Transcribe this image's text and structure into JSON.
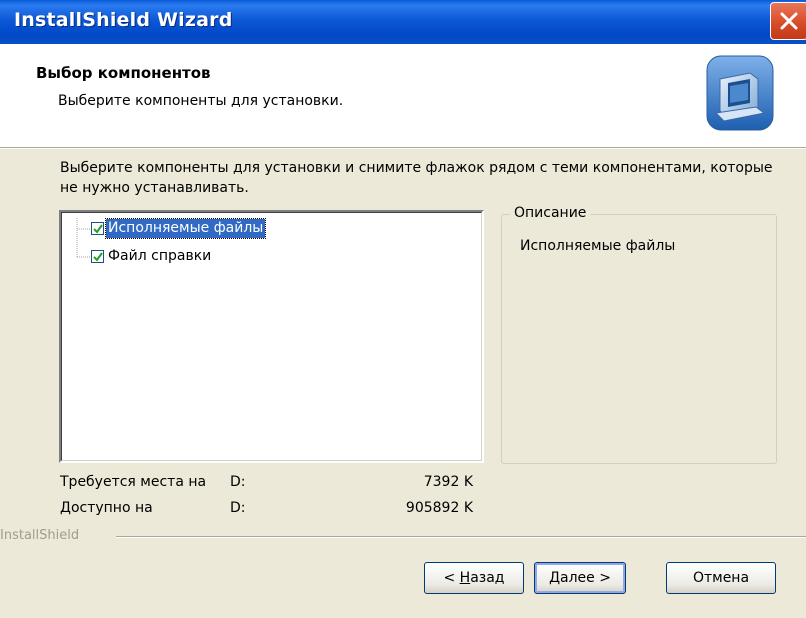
{
  "window": {
    "title": "InstallShield Wizard"
  },
  "header": {
    "title": "Выбор компонентов",
    "subtitle": "Выберите компоненты для установки."
  },
  "instructions": "Выберите компоненты для установки и снимите флажок рядом с теми компонентами, которые не нужно устанавливать.",
  "components": [
    {
      "label": "Исполняемые файлы",
      "checked": true,
      "selected": true
    },
    {
      "label": "Файл справки",
      "checked": true,
      "selected": false
    }
  ],
  "description": {
    "legend": "Описание",
    "text": "Исполняемые файлы"
  },
  "space": {
    "required_label": "Требуется места на",
    "required_drive": "D:",
    "required_size": "7392 K",
    "available_label": "Доступно на",
    "available_drive": "D:",
    "available_size": "905892 K"
  },
  "branding": "InstallShield",
  "buttons": {
    "back_accel": "Н",
    "back_rest": "азад",
    "back_prefix": "< ",
    "next_accel": "Д",
    "next_rest": "алее >",
    "cancel": "Отмена"
  },
  "colors": {
    "titlebar": "#0a54d4",
    "face": "#ece9d8",
    "selection": "#316ac5",
    "close": "#d54a26"
  }
}
